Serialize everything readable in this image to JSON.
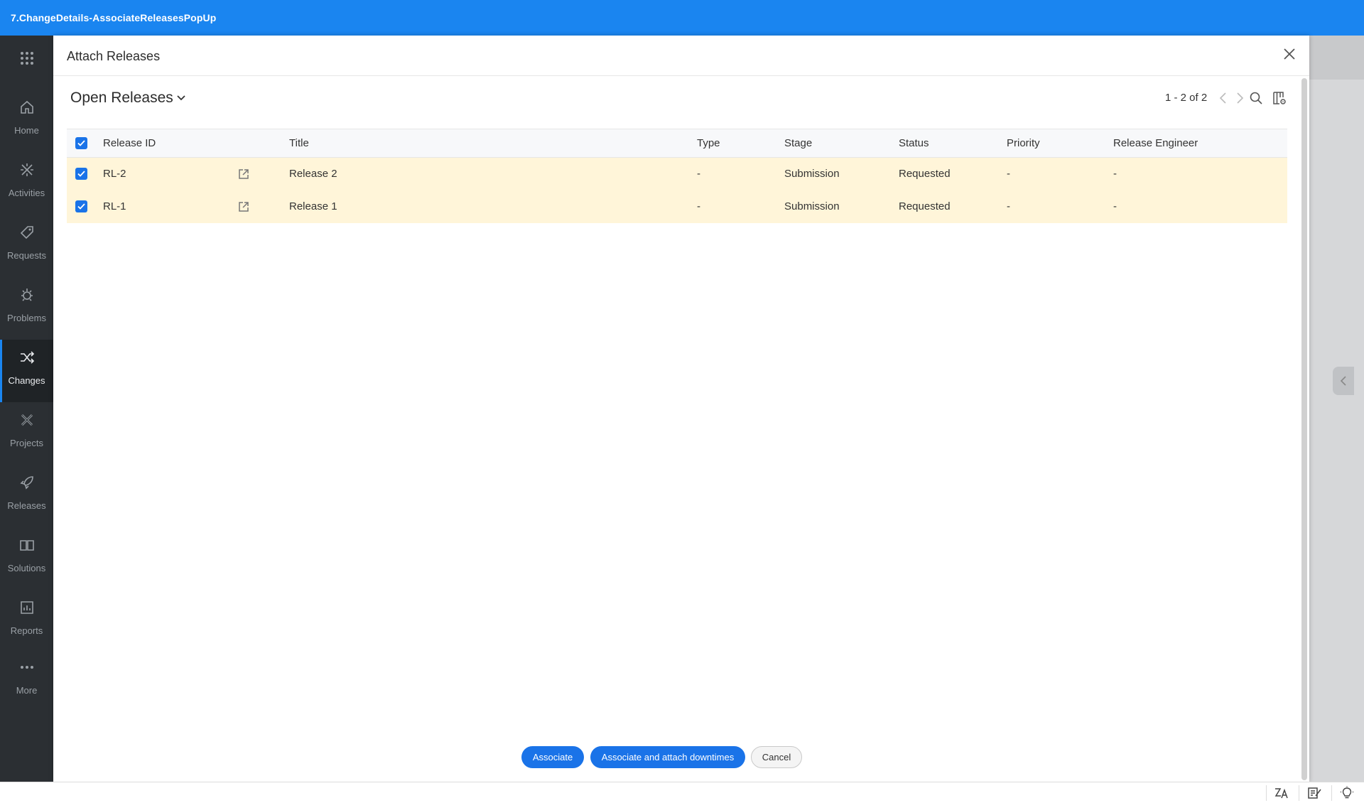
{
  "window": {
    "title": "7.ChangeDetails-AssociateReleasesPopUp"
  },
  "sidebar": {
    "items": [
      {
        "label": "Home",
        "icon": "home-icon"
      },
      {
        "label": "Activities",
        "icon": "activities-icon"
      },
      {
        "label": "Requests",
        "icon": "requests-icon"
      },
      {
        "label": "Problems",
        "icon": "problems-icon"
      },
      {
        "label": "Changes",
        "icon": "changes-icon",
        "active": true
      },
      {
        "label": "Projects",
        "icon": "projects-icon"
      },
      {
        "label": "Releases",
        "icon": "releases-icon"
      },
      {
        "label": "Solutions",
        "icon": "solutions-icon"
      },
      {
        "label": "Reports",
        "icon": "reports-icon"
      },
      {
        "label": "More",
        "icon": "more-icon"
      }
    ]
  },
  "modal": {
    "title": "Attach Releases",
    "view_selector": "Open Releases",
    "pagination": "1 - 2 of 2",
    "table": {
      "headers": [
        "Release ID",
        "Title",
        "Type",
        "Stage",
        "Status",
        "Priority",
        "Release Engineer"
      ],
      "rows": [
        {
          "id": "RL-2",
          "title": "Release 2",
          "type": "-",
          "stage": "Submission",
          "status": "Requested",
          "priority": "-",
          "engineer": "-",
          "checked": true
        },
        {
          "id": "RL-1",
          "title": "Release 1",
          "type": "-",
          "stage": "Submission",
          "status": "Requested",
          "priority": "-",
          "engineer": "-",
          "checked": true
        }
      ]
    },
    "buttons": {
      "associate": "Associate",
      "associate_downtimes": "Associate and attach downtimes",
      "cancel": "Cancel"
    }
  },
  "colors": {
    "topbar": "#1a85f0",
    "sidebar": "#2b2f33",
    "primary_button": "#1a73e8",
    "selected_row": "#fff5d9"
  }
}
